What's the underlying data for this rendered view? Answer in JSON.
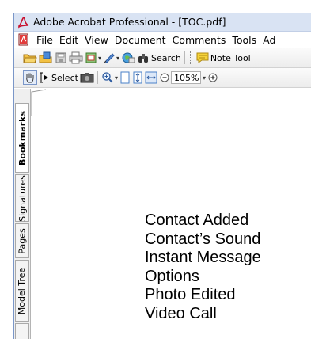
{
  "window": {
    "title": "Adobe Acrobat Professional - [TOC.pdf]"
  },
  "menubar": {
    "items": [
      "File",
      "Edit",
      "View",
      "Document",
      "Comments",
      "Tools",
      "Ad"
    ]
  },
  "toolbar1": {
    "search_label": "Search",
    "note_label": "Note Tool"
  },
  "toolbar2": {
    "select_label": "Select",
    "zoom_value": "105%"
  },
  "sidetabs": [
    "Bookmarks",
    "Signatures",
    "Pages",
    "Model Tree"
  ],
  "document": {
    "lines": [
      "Contact Added",
      "Contact’s Sound",
      "Instant Message",
      "Options",
      "Photo Edited",
      "Video Call"
    ]
  },
  "colors": {
    "titlebar": "#d9e3f3",
    "accent": "#2d5fa8",
    "note_yellow": "#f5d33a"
  },
  "icons": [
    "acrobat-app-icon",
    "pdf-document-icon",
    "open-folder-icon",
    "create-pdf-icon",
    "save-icon",
    "print-icon",
    "email-icon",
    "sign-icon",
    "globe-icon",
    "binoculars-icon",
    "note-icon",
    "hand-icon",
    "select-text-icon",
    "snapshot-icon",
    "zoom-in-icon",
    "actual-size-icon",
    "fit-page-icon",
    "fit-width-icon",
    "zoom-out-minus-icon",
    "zoom-plus-icon"
  ]
}
